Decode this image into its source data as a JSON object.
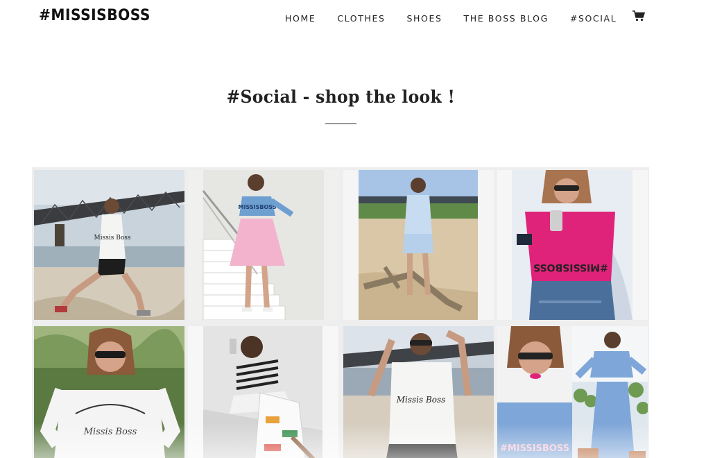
{
  "brand": {
    "logo_text": "#MISSISBOSS"
  },
  "nav": {
    "items": [
      {
        "label": "HOME"
      },
      {
        "label": "CLOTHES"
      },
      {
        "label": "SHOES"
      },
      {
        "label": "THE BOSS BLOG"
      },
      {
        "label": "#SOCIAL"
      }
    ],
    "cart_icon": "cart-icon"
  },
  "page": {
    "title": "#Social - shop the look !"
  },
  "gallery": {
    "photos": [
      {
        "icon": "photo-woman-lunging-bridge",
        "shirt_text": "Missis Boss"
      },
      {
        "icon": "photo-woman-stairs-pink-skirt",
        "shirt_text": "MISSISBOSS"
      },
      {
        "icon": "photo-woman-beach-driftwood",
        "shirt_text": ""
      },
      {
        "icon": "photo-woman-pink-top-selfie",
        "shirt_text": "#MISSISBOSS"
      },
      {
        "icon": "photo-woman-white-sweatshirt",
        "shirt_text": "Missis Boss"
      },
      {
        "icon": "photo-woman-kissing-face-tote",
        "shirt_text": ""
      },
      {
        "icon": "photo-woman-arms-up-bridge",
        "shirt_text": "Missis Boss"
      },
      {
        "icon": "photo-collage-blue-outfit",
        "shirt_text": "#MISSISBOSS"
      }
    ]
  },
  "colors": {
    "accent_pink": "#e0237a",
    "denim_blue": "#7ea6d8",
    "text": "#222222"
  }
}
